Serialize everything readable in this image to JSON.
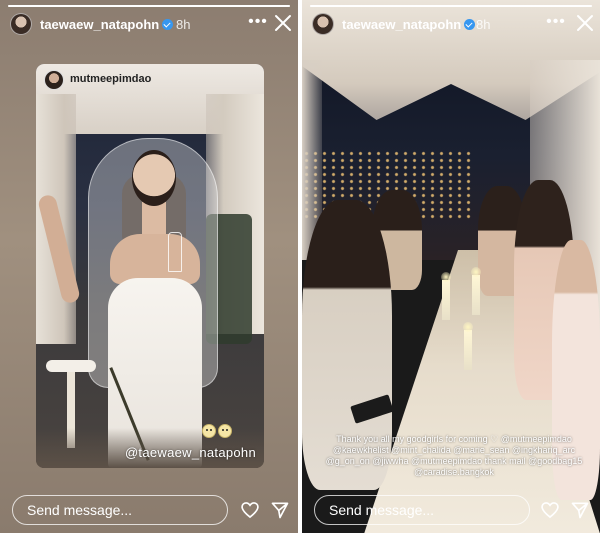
{
  "stories": [
    {
      "username": "taewaew_natapohn",
      "time": "8h",
      "repost": {
        "username": "mutmeepimdao",
        "mention_sticker": "@taewaew_natapohn"
      },
      "footer": {
        "message_placeholder": "Send message..."
      }
    },
    {
      "username": "taewaew_natapohn",
      "time": "8h",
      "caption": "Thank you all my goodgirls for coming ♡ @mutmeepimdao @kaewkhelist @mint_chalida @marie_sean @ingkhariq_arc @g_on_on @jiwwha @mutmeepimdao thank mail @goodbag15 @caradise.bangkok",
      "footer": {
        "message_placeholder": "Send message..."
      }
    }
  ],
  "icons": {
    "more": "more-horizontal-icon",
    "close": "close-icon",
    "like": "heart-icon",
    "share": "send-icon",
    "verified": "verified-badge-icon"
  },
  "colors": {
    "verified": "#3797f0",
    "text": "#ffffff"
  }
}
